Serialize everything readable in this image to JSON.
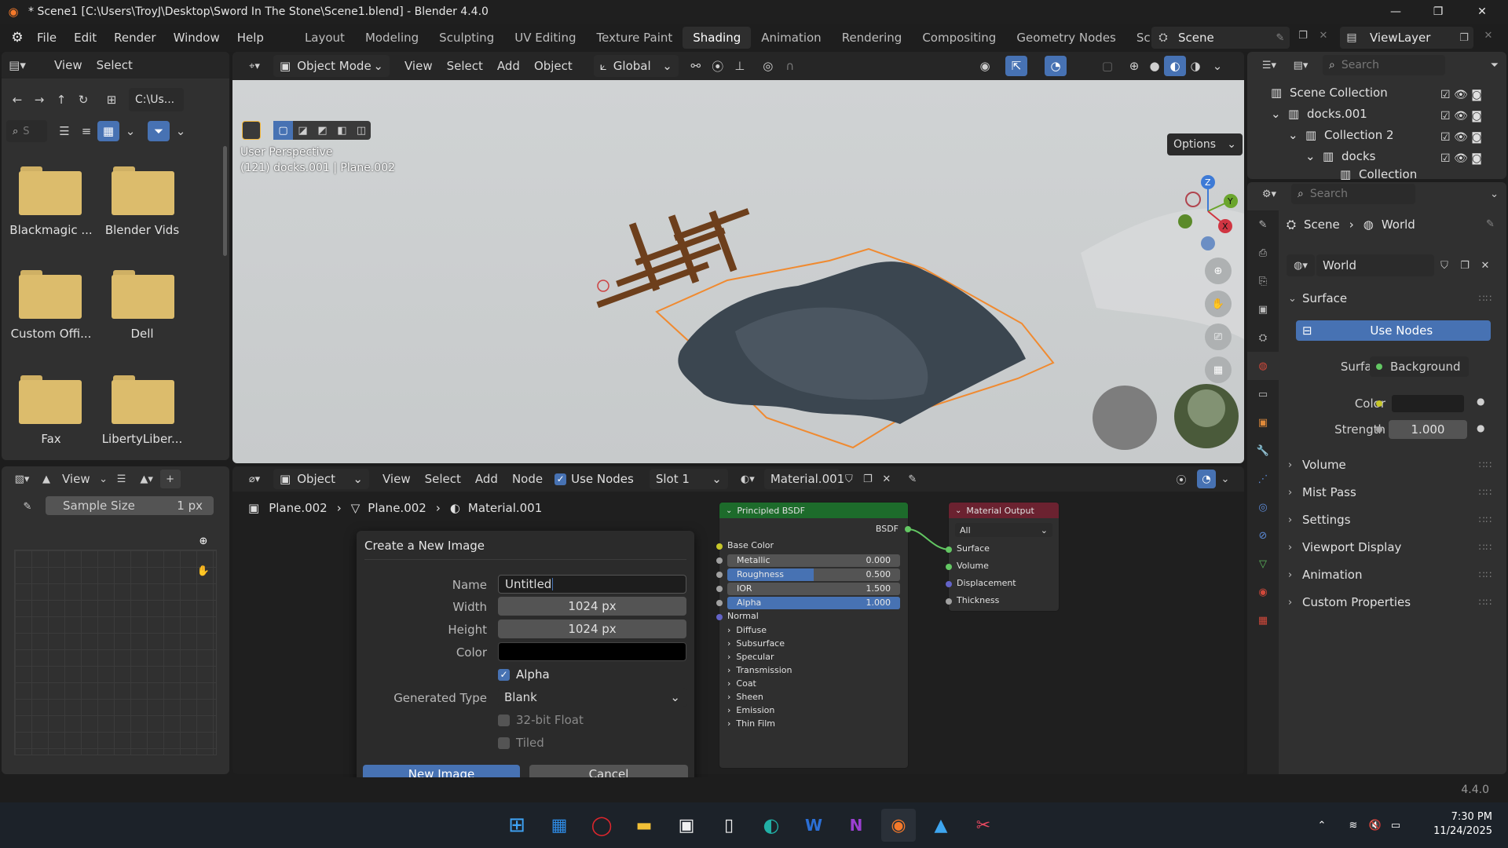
{
  "window": {
    "title": "* Scene1 [C:\\Users\\TroyJ\\Desktop\\Sword In The Stone\\Scene1.blend] - Blender 4.4.0",
    "controls": {
      "minimize": "—",
      "maximize": "❐",
      "close": "✕"
    }
  },
  "menu": [
    "File",
    "Edit",
    "Render",
    "Window",
    "Help"
  ],
  "workspaces": [
    "Layout",
    "Modeling",
    "Sculpting",
    "UV Editing",
    "Texture Paint",
    "Shading",
    "Animation",
    "Rendering",
    "Compositing",
    "Geometry Nodes",
    "Scripti"
  ],
  "active_workspace": "Shading",
  "scene_name": "Scene",
  "view_layer": "ViewLayer",
  "file_browser": {
    "view": "View",
    "select": "Select",
    "path": "C:\\Us...",
    "search_placeholder": "S",
    "folders": [
      "Blackmagic ...",
      "Blender Vids",
      "Custom Offi...",
      "Dell",
      "Fax",
      "LibertyLiber..."
    ]
  },
  "viewport": {
    "mode": "Object Mode",
    "menus": [
      "View",
      "Select",
      "Add",
      "Object"
    ],
    "orientation": "Global",
    "options": "Options",
    "overlay_line1": "User Perspective",
    "overlay_line2": "(121) docks.001 | Plane.002",
    "gizmo": {
      "z": "Z",
      "y": "Y",
      "x": "X"
    }
  },
  "outliner": {
    "search_placeholder": "Search",
    "items": [
      "Scene Collection",
      "docks.001",
      "Collection 2",
      "docks",
      "Collection"
    ]
  },
  "image_editor": {
    "view": "View",
    "sample_size_label": "Sample Size",
    "sample_size_value": "1 px"
  },
  "node_editor": {
    "type": "Object",
    "menus": [
      "View",
      "Select",
      "Add",
      "Node"
    ],
    "use_nodes": "Use Nodes",
    "slot": "Slot 1",
    "material": "Material.001",
    "breadcrumb": [
      "Plane.002",
      "Plane.002",
      "Material.001"
    ]
  },
  "dialog": {
    "title": "Create a New Image",
    "name_label": "Name",
    "name_value": "Untitled",
    "width_label": "Width",
    "width_value": "1024 px",
    "height_label": "Height",
    "height_value": "1024 px",
    "color_label": "Color",
    "alpha_label": "Alpha",
    "generated_type_label": "Generated Type",
    "generated_type_value": "Blank",
    "float_label": "32-bit Float",
    "tiled_label": "Tiled",
    "ok": "New Image",
    "cancel": "Cancel"
  },
  "bsdf_node": {
    "title": "Principled BSDF",
    "output": "BSDF",
    "base_color": "Base Color",
    "metallic": {
      "label": "Metallic",
      "value": "0.000",
      "fraction": 0
    },
    "roughness": {
      "label": "Roughness",
      "value": "0.500",
      "fraction": 0.5
    },
    "ior": {
      "label": "IOR",
      "value": "1.500",
      "fraction": 0
    },
    "alpha": {
      "label": "Alpha",
      "value": "1.000",
      "fraction": 1
    },
    "normal": "Normal",
    "panels": [
      "Diffuse",
      "Subsurface",
      "Specular",
      "Transmission",
      "Coat",
      "Sheen",
      "Emission",
      "Thin Film"
    ]
  },
  "output_node": {
    "title": "Material Output",
    "target": "All",
    "inputs": [
      "Surface",
      "Volume",
      "Displacement",
      "Thickness"
    ]
  },
  "properties": {
    "search_placeholder": "Search",
    "breadcrumb_scene": "Scene",
    "breadcrumb_world": "World",
    "world_name": "World",
    "surface_header": "Surface",
    "use_nodes_button": "Use Nodes",
    "surface_label": "Surface",
    "surface_value": "Background",
    "color_label": "Color",
    "strength_label": "Strength",
    "strength_value": "1.000",
    "sections": [
      "Volume",
      "Mist Pass",
      "Settings",
      "Viewport Display",
      "Animation",
      "Custom Properties"
    ]
  },
  "status_version": "4.4.0",
  "taskbar": {
    "time": "7:30 PM",
    "date": "11/24/2025"
  },
  "colors": {
    "accent": "#4772b3",
    "bsdf_header": "#1d6b2b",
    "output_header": "#6b2230",
    "folder": "#dcbc6c",
    "selection_orange": "#f08a30"
  }
}
